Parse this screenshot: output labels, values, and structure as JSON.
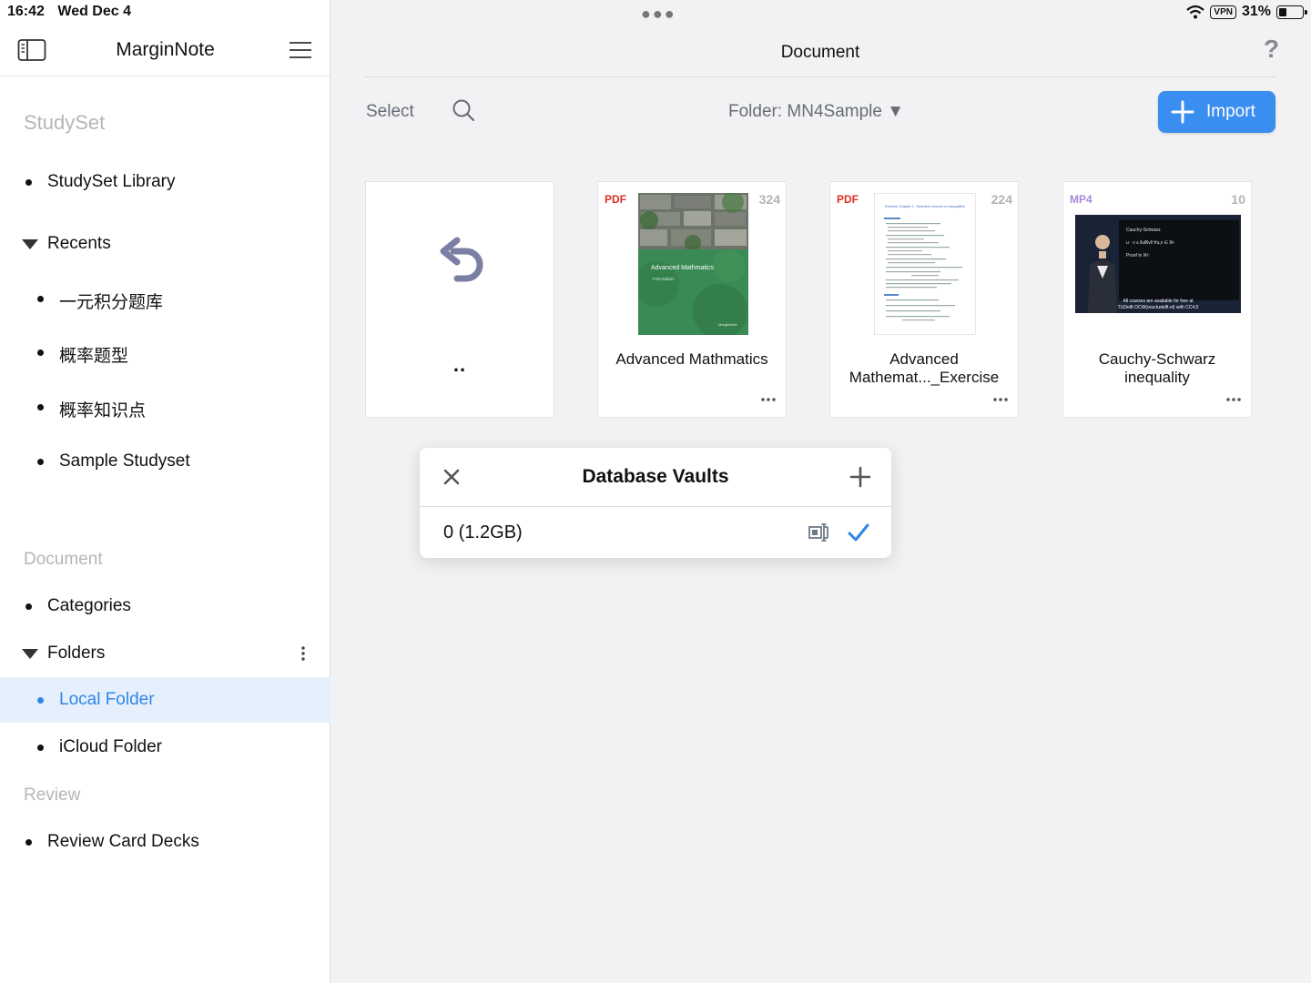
{
  "status_bar": {
    "time": "16:42",
    "date": "Wed Dec 4",
    "vpn": "VPN",
    "battery": "31%"
  },
  "sidebar": {
    "app_title": "MarginNote",
    "studyset_label": "StudySet",
    "studyset_library": "StudySet Library",
    "recents_label": "Recents",
    "recents": [
      "一元积分题库",
      "概率题型",
      "概率知识点",
      "Sample Studyset"
    ],
    "document_label": "Document",
    "categories": "Categories",
    "folders_label": "Folders",
    "local_folder": "Local Folder",
    "icloud_folder": "iCloud Folder",
    "review_label": "Review",
    "review_decks": "Review Card Decks"
  },
  "main": {
    "title": "Document",
    "help": "?",
    "select_label": "Select",
    "folder_selector": "Folder: MN4Sample ▼",
    "import_label": "Import",
    "parent_folder": "..",
    "cards": [
      {
        "type": "PDF",
        "pages": "324",
        "name": "Advanced Mathmatics",
        "cover_title": "Advanced Mathmatics",
        "cover_subtitle": "First Edition",
        "cover_brand": "MarginNote"
      },
      {
        "type": "PDF",
        "pages": "224",
        "name": "Advanced Mathemat..._Exercise",
        "cover_title": "Exercise: Chapter 1 - Selected Lectures on Inequalities"
      },
      {
        "type": "MP4",
        "pages": "10",
        "name": "Cauchy-Schwarz inequality",
        "board_title": "Cauchy-Schwarz",
        "board_line1": "u · v ≤ ‖u‖‖v‖  ∀u,v ∈ ℝⁿ",
        "board_line2": "Proof in ℝ²:",
        "caption1": "All courses are available for free at",
        "caption2": "TUDelft OCW(ocw.tudelft.nl) with CC4.0"
      }
    ]
  },
  "popover": {
    "title": "Database Vaults",
    "vault_name": "0  (1.2GB)"
  },
  "colors": {
    "accent": "#3a8ef0",
    "active_bg": "#e6f0fc",
    "pdf_badge": "#d93025",
    "mp4_badge": "#a58ad8"
  }
}
